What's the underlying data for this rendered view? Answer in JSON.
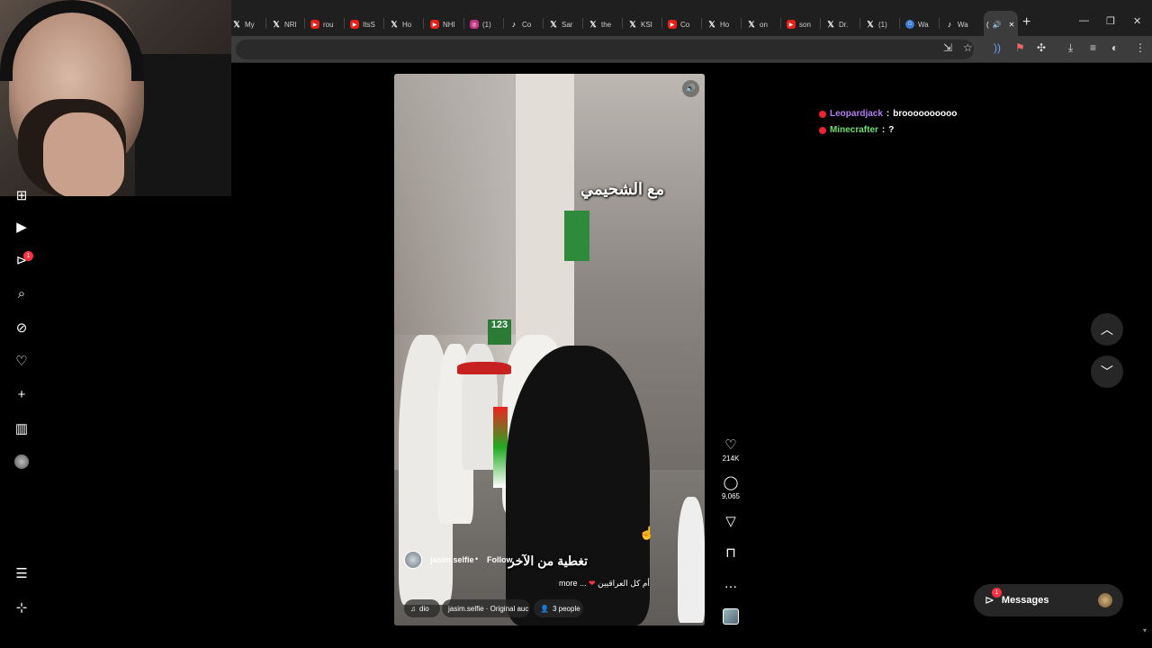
{
  "browser": {
    "tabs": [
      {
        "label": "My",
        "icon": "x-icon"
      },
      {
        "label": "NRI",
        "icon": "x-icon"
      },
      {
        "label": "rou",
        "icon": "youtube-icon"
      },
      {
        "label": "ItsS",
        "icon": "youtube-icon"
      },
      {
        "label": "Ho",
        "icon": "x-icon"
      },
      {
        "label": "NHI",
        "icon": "youtube-icon"
      },
      {
        "label": "(1)",
        "icon": "instagram-icon"
      },
      {
        "label": "Co",
        "icon": "tiktok-icon"
      },
      {
        "label": "Sar",
        "icon": "x-icon"
      },
      {
        "label": "the",
        "icon": "x-icon"
      },
      {
        "label": "KSI",
        "icon": "x-icon"
      },
      {
        "label": "Co",
        "icon": "youtube-icon"
      },
      {
        "label": "Ho",
        "icon": "x-icon"
      },
      {
        "label": "on",
        "icon": "x-icon"
      },
      {
        "label": "son",
        "icon": "youtube-icon"
      },
      {
        "label": "Dr.",
        "icon": "x-icon"
      },
      {
        "label": "(1)",
        "icon": "x-icon"
      },
      {
        "label": "Wa",
        "icon": "web-icon"
      },
      {
        "label": "Wa",
        "icon": "tiktok-icon"
      }
    ],
    "active_tab_label": "(",
    "new_tab": "+"
  },
  "nav": {
    "notifications_badge": "1"
  },
  "video": {
    "overlay_top": "مع الشحيمي",
    "overlay_bottom": "تغطية من الآخر",
    "sign_number": "123",
    "author": "jasim.selfie",
    "separator": "•",
    "follow_label": "Follow",
    "caption_text": "أم كل العراقيين",
    "caption_more": "more ...",
    "audio_pill": "dio",
    "audio_source": "jasim.selfie · Original auc",
    "people_pill": "3 people"
  },
  "actions": {
    "likes": "214K",
    "comments": "9,065"
  },
  "chat": [
    {
      "user": "Leopardjack",
      "sep": ":",
      "message": "broooooooooo"
    },
    {
      "user": "Minecrafter",
      "sep": ":",
      "message": "?"
    }
  ],
  "messages": {
    "label": "Messages",
    "badge": "1"
  },
  "colors": {
    "like_red": "#ff3040",
    "chat_user_1": "#b57ef5",
    "chat_user_2": "#6fe06f"
  }
}
